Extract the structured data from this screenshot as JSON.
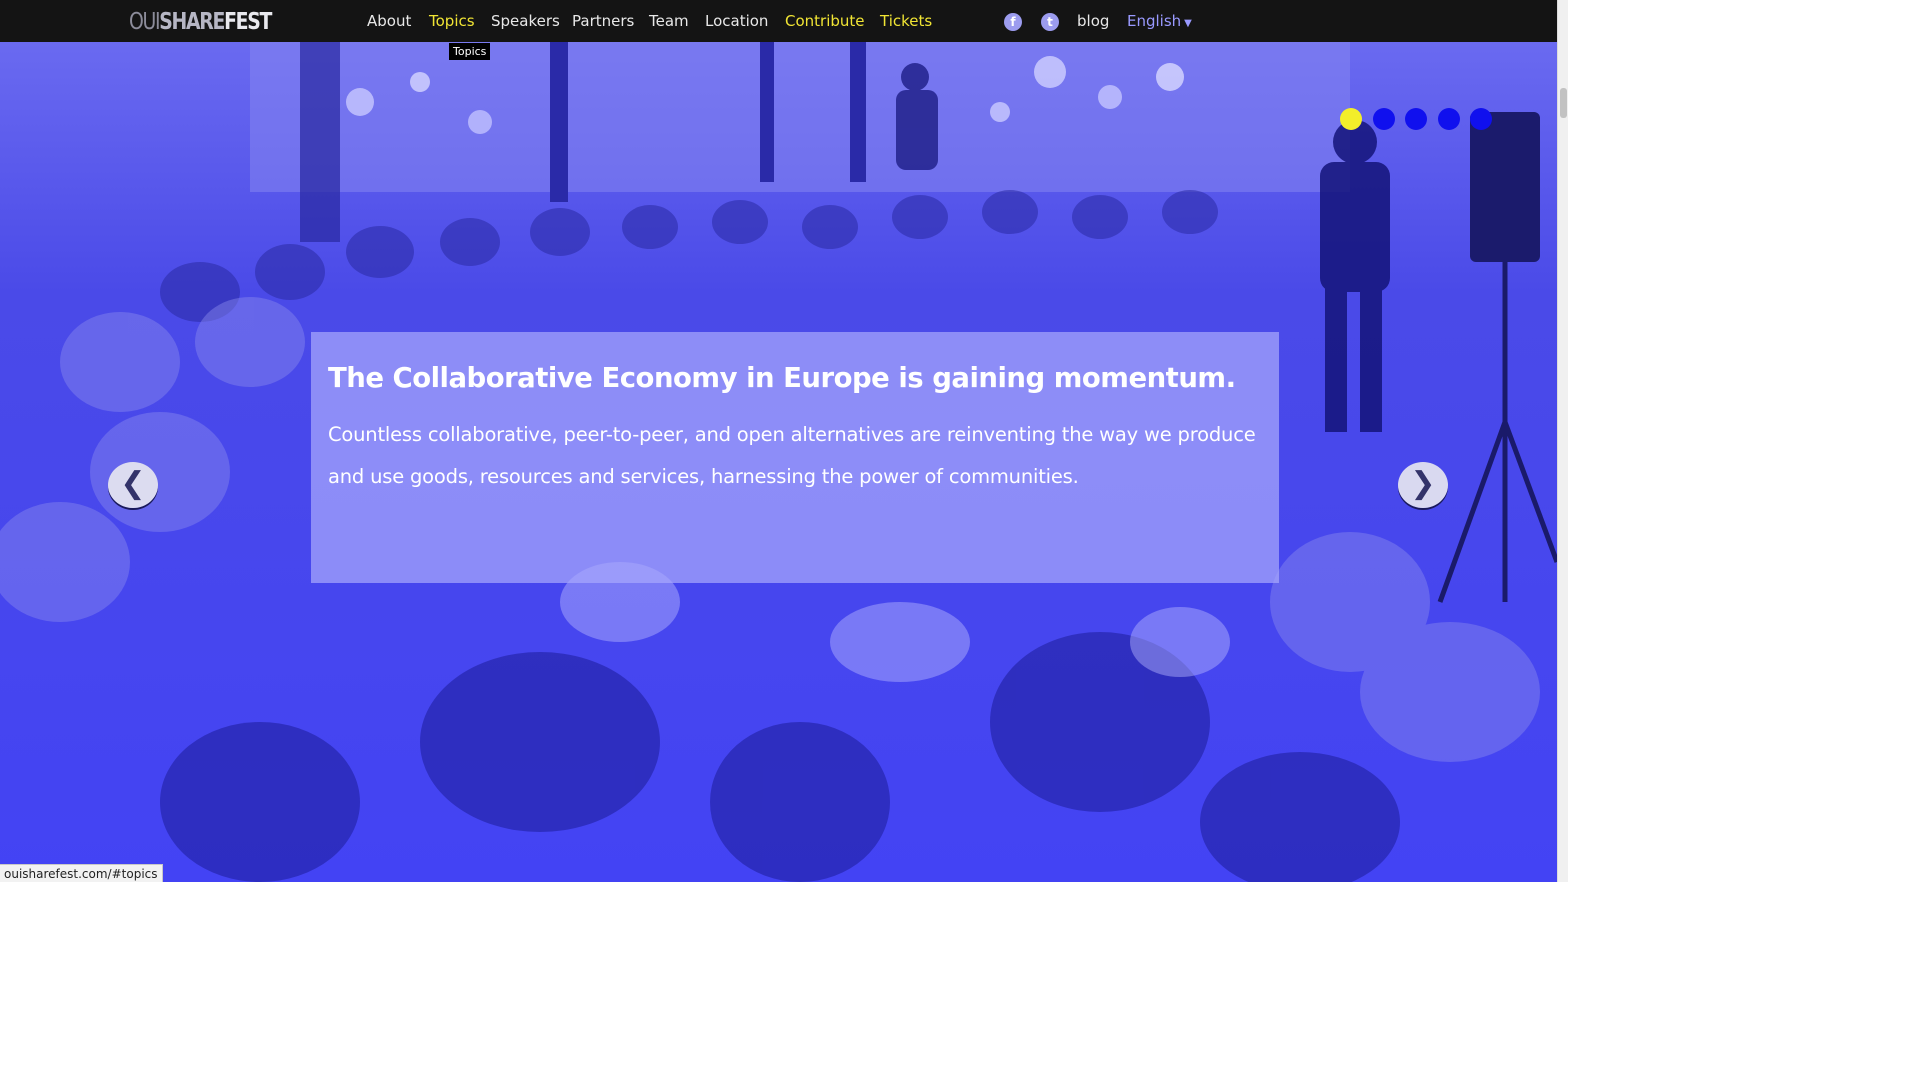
{
  "logo": {
    "part1": "OUI",
    "part2": "SHARE",
    "part3": "FEST"
  },
  "nav": {
    "items": [
      {
        "label": "About",
        "highlight": false
      },
      {
        "label": "Topics",
        "highlight": true
      },
      {
        "label": "Speakers",
        "highlight": false
      },
      {
        "label": "Partners",
        "highlight": false
      },
      {
        "label": "Team",
        "highlight": false
      },
      {
        "label": "Location",
        "highlight": false
      },
      {
        "label": "Contribute",
        "highlight": true
      },
      {
        "label": "Tickets",
        "highlight": true
      }
    ],
    "social": [
      {
        "icon": "facebook-icon",
        "glyph": "f"
      },
      {
        "icon": "twitter-icon",
        "glyph": "t"
      }
    ],
    "blog_label": "blog",
    "language": "English",
    "tooltip": "Topics"
  },
  "hero": {
    "title": "The Collaborative Economy in Europe is gaining momentum.",
    "body": "Countless collaborative, peer-to-peer, and open alternatives are reinventing the way we produce and use goods, resources and services, harnessing the power of communities.",
    "prev_glyph": "❮",
    "next_glyph": "❯",
    "slide_count": 5,
    "active_slide": 1
  },
  "status_bar": "ouisharefest.com/#topics",
  "colors": {
    "navbar_bg": "#141414",
    "highlight": "#f1e534",
    "hero_blue": "#4242f4",
    "dot_blue": "#1010ee",
    "dot_active": "#f3ee2a",
    "language": "#9a9aff"
  }
}
